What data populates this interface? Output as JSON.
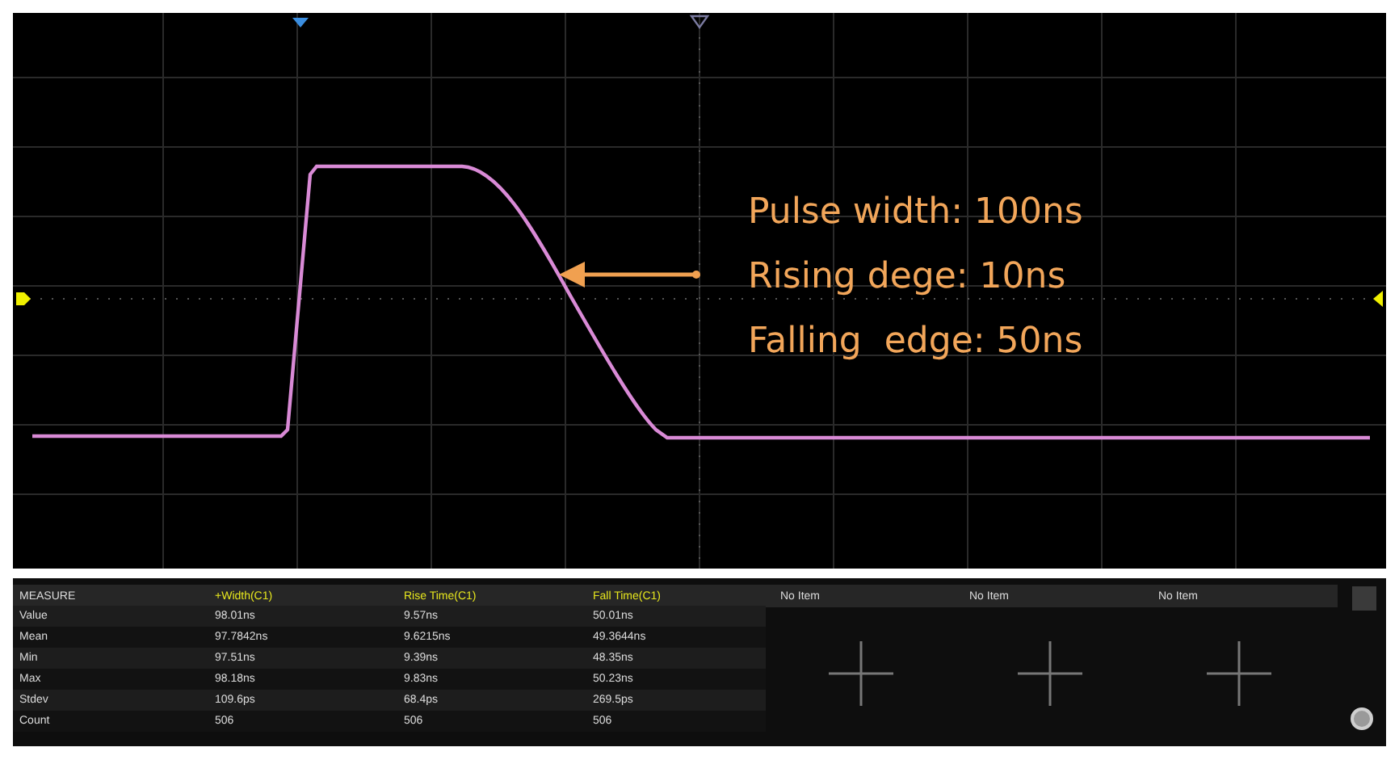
{
  "annotation": {
    "lines": [
      "Pulse width: 100ns",
      "Rising dege: 10ns",
      "Falling  edge: 50ns"
    ]
  },
  "measure": {
    "title": "MEASURE",
    "columns": [
      {
        "label": "+Width(C1)"
      },
      {
        "label": "Rise Time(C1)"
      },
      {
        "label": "Fall Time(C1)"
      }
    ],
    "rows": [
      {
        "label": "Value",
        "cells": [
          "98.01ns",
          "9.57ns",
          "50.01ns"
        ]
      },
      {
        "label": "Mean",
        "cells": [
          "97.7842ns",
          "9.6215ns",
          "49.3644ns"
        ]
      },
      {
        "label": "Min",
        "cells": [
          "97.51ns",
          "9.39ns",
          "48.35ns"
        ]
      },
      {
        "label": "Max",
        "cells": [
          "98.18ns",
          "9.83ns",
          "50.23ns"
        ]
      },
      {
        "label": "Stdev",
        "cells": [
          "109.6ps",
          "68.4ps",
          "269.5ps"
        ]
      },
      {
        "label": "Count",
        "cells": [
          "506",
          "506",
          "506"
        ]
      }
    ],
    "empty_slots": [
      {
        "label": "No Item"
      },
      {
        "label": "No Item"
      },
      {
        "label": "No Item"
      }
    ]
  }
}
